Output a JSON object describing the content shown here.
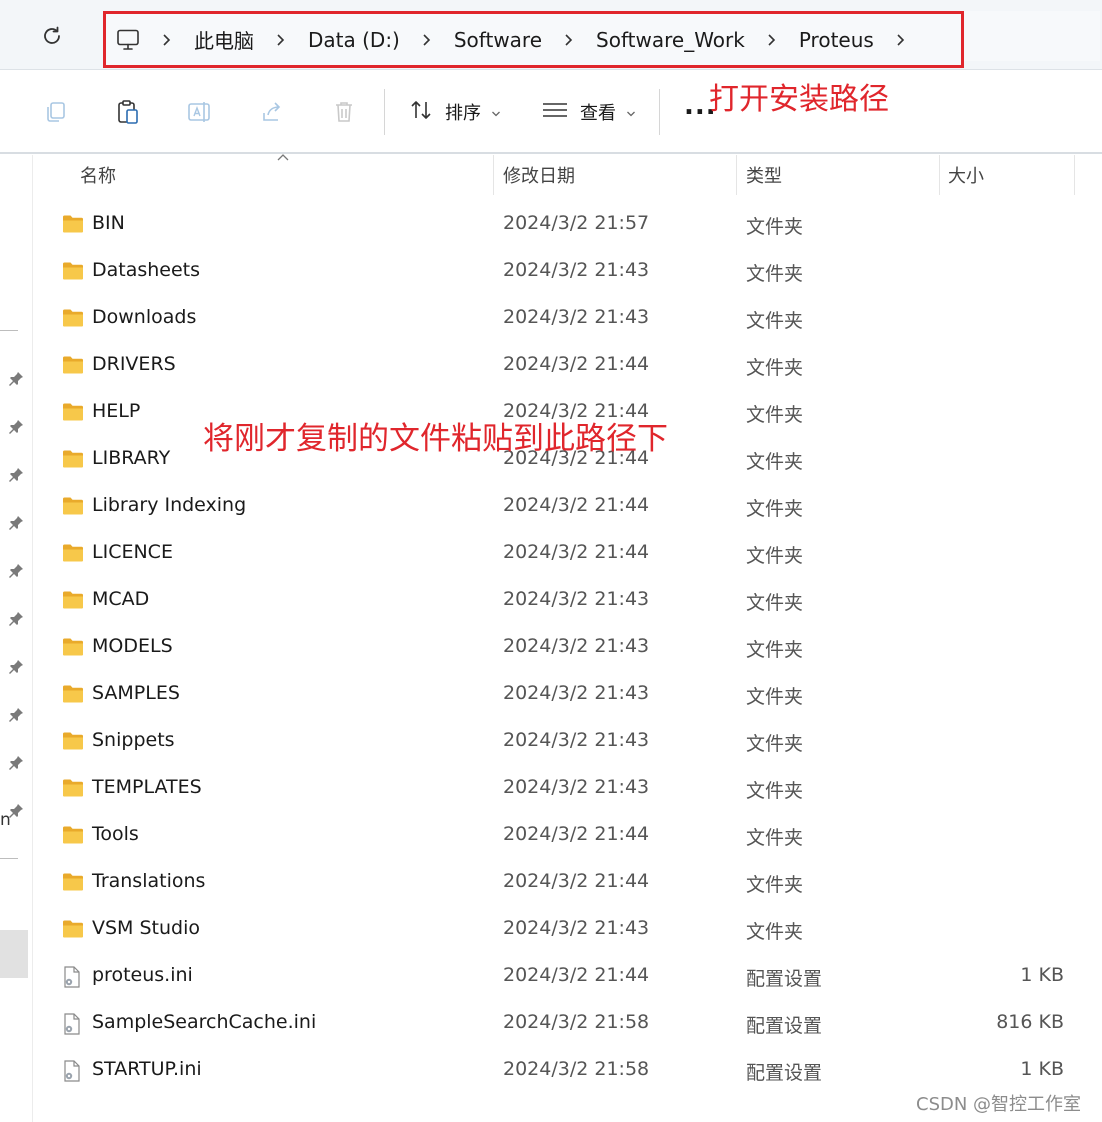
{
  "address_bar": {
    "breadcrumbs": [
      "此电脑",
      "Data (D:)",
      "Software",
      "Software_Work",
      "Proteus"
    ]
  },
  "toolbar": {
    "sort_label": "排序",
    "view_label": "查看",
    "more_label": "..."
  },
  "annotations": {
    "open_path": "打开安装路径",
    "paste_here": "将刚才复制的文件粘贴到此路径下"
  },
  "columns": {
    "name": "名称",
    "modified": "修改日期",
    "type": "类型",
    "size": "大小"
  },
  "left_pane": {
    "partial_text": "n"
  },
  "files": [
    {
      "name": "BIN",
      "modified": "2024/3/2 21:57",
      "type": "文件夹",
      "size": "",
      "icon": "folder-icon"
    },
    {
      "name": "Datasheets",
      "modified": "2024/3/2 21:43",
      "type": "文件夹",
      "size": "",
      "icon": "folder-icon"
    },
    {
      "name": "Downloads",
      "modified": "2024/3/2 21:43",
      "type": "文件夹",
      "size": "",
      "icon": "folder-icon"
    },
    {
      "name": "DRIVERS",
      "modified": "2024/3/2 21:44",
      "type": "文件夹",
      "size": "",
      "icon": "folder-icon"
    },
    {
      "name": "HELP",
      "modified": "2024/3/2 21:44",
      "type": "文件夹",
      "size": "",
      "icon": "folder-icon"
    },
    {
      "name": "LIBRARY",
      "modified": "2024/3/2 21:44",
      "type": "文件夹",
      "size": "",
      "icon": "folder-icon"
    },
    {
      "name": "Library Indexing",
      "modified": "2024/3/2 21:44",
      "type": "文件夹",
      "size": "",
      "icon": "folder-icon"
    },
    {
      "name": "LICENCE",
      "modified": "2024/3/2 21:44",
      "type": "文件夹",
      "size": "",
      "icon": "folder-icon"
    },
    {
      "name": "MCAD",
      "modified": "2024/3/2 21:43",
      "type": "文件夹",
      "size": "",
      "icon": "folder-icon"
    },
    {
      "name": "MODELS",
      "modified": "2024/3/2 21:43",
      "type": "文件夹",
      "size": "",
      "icon": "folder-icon"
    },
    {
      "name": "SAMPLES",
      "modified": "2024/3/2 21:43",
      "type": "文件夹",
      "size": "",
      "icon": "folder-icon"
    },
    {
      "name": "Snippets",
      "modified": "2024/3/2 21:43",
      "type": "文件夹",
      "size": "",
      "icon": "folder-icon"
    },
    {
      "name": "TEMPLATES",
      "modified": "2024/3/2 21:43",
      "type": "文件夹",
      "size": "",
      "icon": "folder-icon"
    },
    {
      "name": "Tools",
      "modified": "2024/3/2 21:44",
      "type": "文件夹",
      "size": "",
      "icon": "folder-icon"
    },
    {
      "name": "Translations",
      "modified": "2024/3/2 21:44",
      "type": "文件夹",
      "size": "",
      "icon": "folder-icon"
    },
    {
      "name": "VSM Studio",
      "modified": "2024/3/2 21:43",
      "type": "文件夹",
      "size": "",
      "icon": "folder-icon"
    },
    {
      "name": "proteus.ini",
      "modified": "2024/3/2 21:44",
      "type": "配置设置",
      "size": "1 KB",
      "icon": "settings-file-icon"
    },
    {
      "name": "SampleSearchCache.ini",
      "modified": "2024/3/2 21:58",
      "type": "配置设置",
      "size": "816 KB",
      "icon": "settings-file-icon"
    },
    {
      "name": "STARTUP.ini",
      "modified": "2024/3/2 21:58",
      "type": "配置设置",
      "size": "1 KB",
      "icon": "settings-file-icon"
    }
  ],
  "watermark": "CSDN @智控工作室",
  "colors": {
    "annotation_red": "#e0262c",
    "folder_yellow": "#f7c84a"
  }
}
